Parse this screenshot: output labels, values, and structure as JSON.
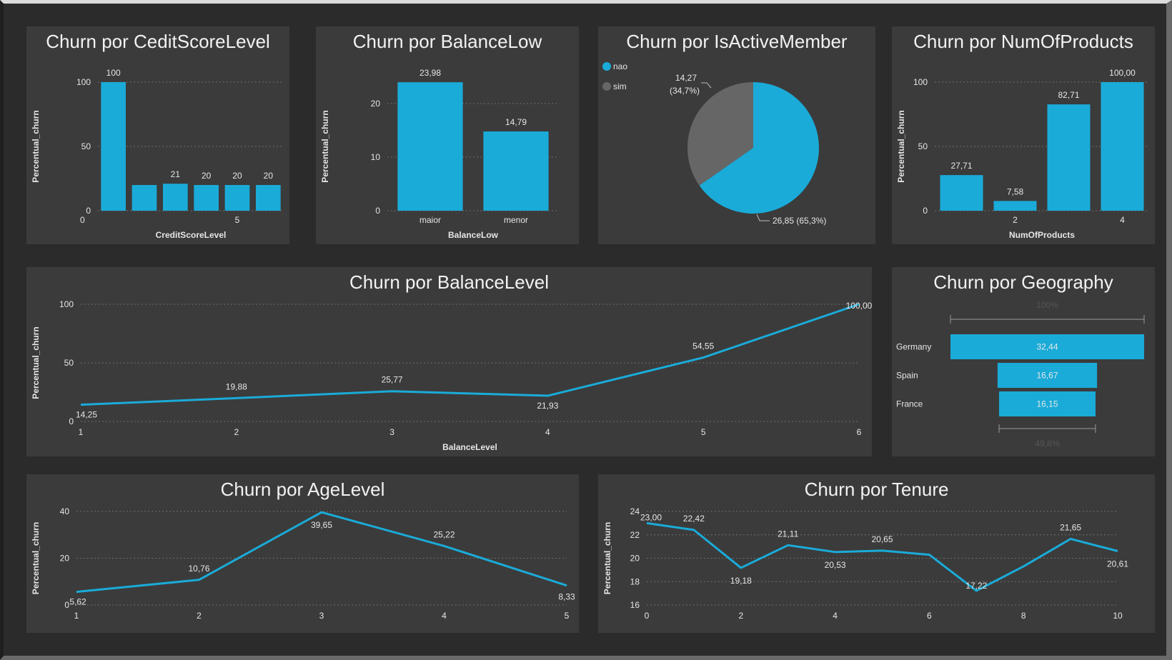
{
  "colors": {
    "accent": "#1aabd8",
    "gray_slice": "#666666",
    "panel_bg": "#3b3b3b",
    "text": "#e6e6e6",
    "grid": "#6e6e6e"
  },
  "chart_data": [
    {
      "id": "credit",
      "type": "bar",
      "title": "Churn por CeditScoreLevel",
      "xlabel": "CreditScoreLevel",
      "ylabel": "Percentual_churn",
      "x": [
        1,
        2,
        3,
        4,
        5,
        6
      ],
      "values": [
        100,
        20,
        21,
        20,
        20,
        20
      ],
      "value_labels": [
        "100",
        "",
        "21",
        "20",
        "20",
        "20"
      ],
      "x_ticks": [
        0,
        5
      ],
      "y_ticks": [
        0,
        50,
        100
      ],
      "ylim": [
        0,
        100
      ],
      "grid": true
    },
    {
      "id": "balancelow",
      "type": "bar",
      "title": "Churn por BalanceLow",
      "xlabel": "BalanceLow",
      "ylabel": "Percentual_churn",
      "categories": [
        "maior",
        "menor"
      ],
      "values": [
        23.98,
        14.79
      ],
      "value_labels": [
        "23,98",
        "14,79"
      ],
      "y_ticks": [
        0,
        10,
        20
      ],
      "ylim": [
        0,
        24
      ],
      "grid": true
    },
    {
      "id": "active",
      "type": "pie",
      "title": "Churn por IsActiveMember",
      "legend": [
        "nao",
        "sim"
      ],
      "legend_position": "top-left",
      "slices": [
        {
          "name": "nao",
          "value": 26.85,
          "label": "26,85 (65,3%)"
        },
        {
          "name": "sim",
          "value": 14.27,
          "label": "14,27",
          "label2": "(34,7%)"
        }
      ]
    },
    {
      "id": "products",
      "type": "bar",
      "title": "Churn por NumOfProducts",
      "xlabel": "NumOfProducts",
      "ylabel": "Percentual_churn",
      "x": [
        1,
        2,
        3,
        4
      ],
      "values": [
        27.71,
        7.58,
        82.71,
        100.0
      ],
      "value_labels": [
        "27,71",
        "7,58",
        "82,71",
        "100,00"
      ],
      "x_ticks": [
        2,
        4
      ],
      "y_ticks": [
        0,
        50,
        100
      ],
      "ylim": [
        0,
        100
      ],
      "grid": true
    },
    {
      "id": "balancelevel",
      "type": "line",
      "title": "Churn por BalanceLevel",
      "xlabel": "BalanceLevel",
      "ylabel": "Percentual_churn",
      "x": [
        1,
        2,
        3,
        4,
        5,
        6
      ],
      "values": [
        14.25,
        19.88,
        25.77,
        21.93,
        54.55,
        100.0
      ],
      "value_labels": [
        "14,25",
        "19,88",
        "25,77",
        "21,93",
        "54,55",
        "100,00"
      ],
      "x_ticks": [
        1,
        2,
        3,
        4,
        5,
        6
      ],
      "y_ticks": [
        0,
        50,
        100
      ],
      "ylim": [
        0,
        100
      ],
      "grid": true
    },
    {
      "id": "geography",
      "type": "bar",
      "title": "Churn por Geography",
      "categories": [
        "Germany",
        "Spain",
        "France"
      ],
      "values": [
        32.44,
        16.67,
        16.15
      ],
      "value_labels": [
        "32,44",
        "16,67",
        "16,15"
      ],
      "top_scale_label": "100%",
      "bottom_scale_label": "49,8%"
    },
    {
      "id": "age",
      "type": "line",
      "title": "Churn por AgeLevel",
      "ylabel": "Percentual_churn",
      "x": [
        1,
        2,
        3,
        4,
        5
      ],
      "values": [
        5.62,
        10.76,
        39.65,
        25.22,
        8.33
      ],
      "value_labels": [
        "5,62",
        "10,76",
        "39,65",
        "25,22",
        "8,33"
      ],
      "x_ticks": [
        1,
        2,
        3,
        4,
        5
      ],
      "y_ticks": [
        0,
        20,
        40
      ],
      "ylim": [
        0,
        40
      ],
      "grid": true
    },
    {
      "id": "tenure",
      "type": "line",
      "title": "Churn por Tenure",
      "ylabel": "Percentual_churn",
      "x": [
        0,
        1,
        2,
        3,
        4,
        5,
        6,
        7,
        8,
        9,
        10
      ],
      "values": [
        23.0,
        22.42,
        19.18,
        21.11,
        20.53,
        20.65,
        20.3,
        17.22,
        19.3,
        21.65,
        20.61
      ],
      "value_labels": [
        "23,00",
        "22,42",
        "19,18",
        "21,11",
        "20,53",
        "20,65",
        "",
        "17,22",
        "",
        "21,65",
        "20,61"
      ],
      "x_ticks": [
        0,
        2,
        4,
        6,
        8,
        10
      ],
      "y_ticks": [
        16,
        18,
        20,
        22,
        24
      ],
      "ylim": [
        16,
        24
      ],
      "grid": true
    }
  ]
}
